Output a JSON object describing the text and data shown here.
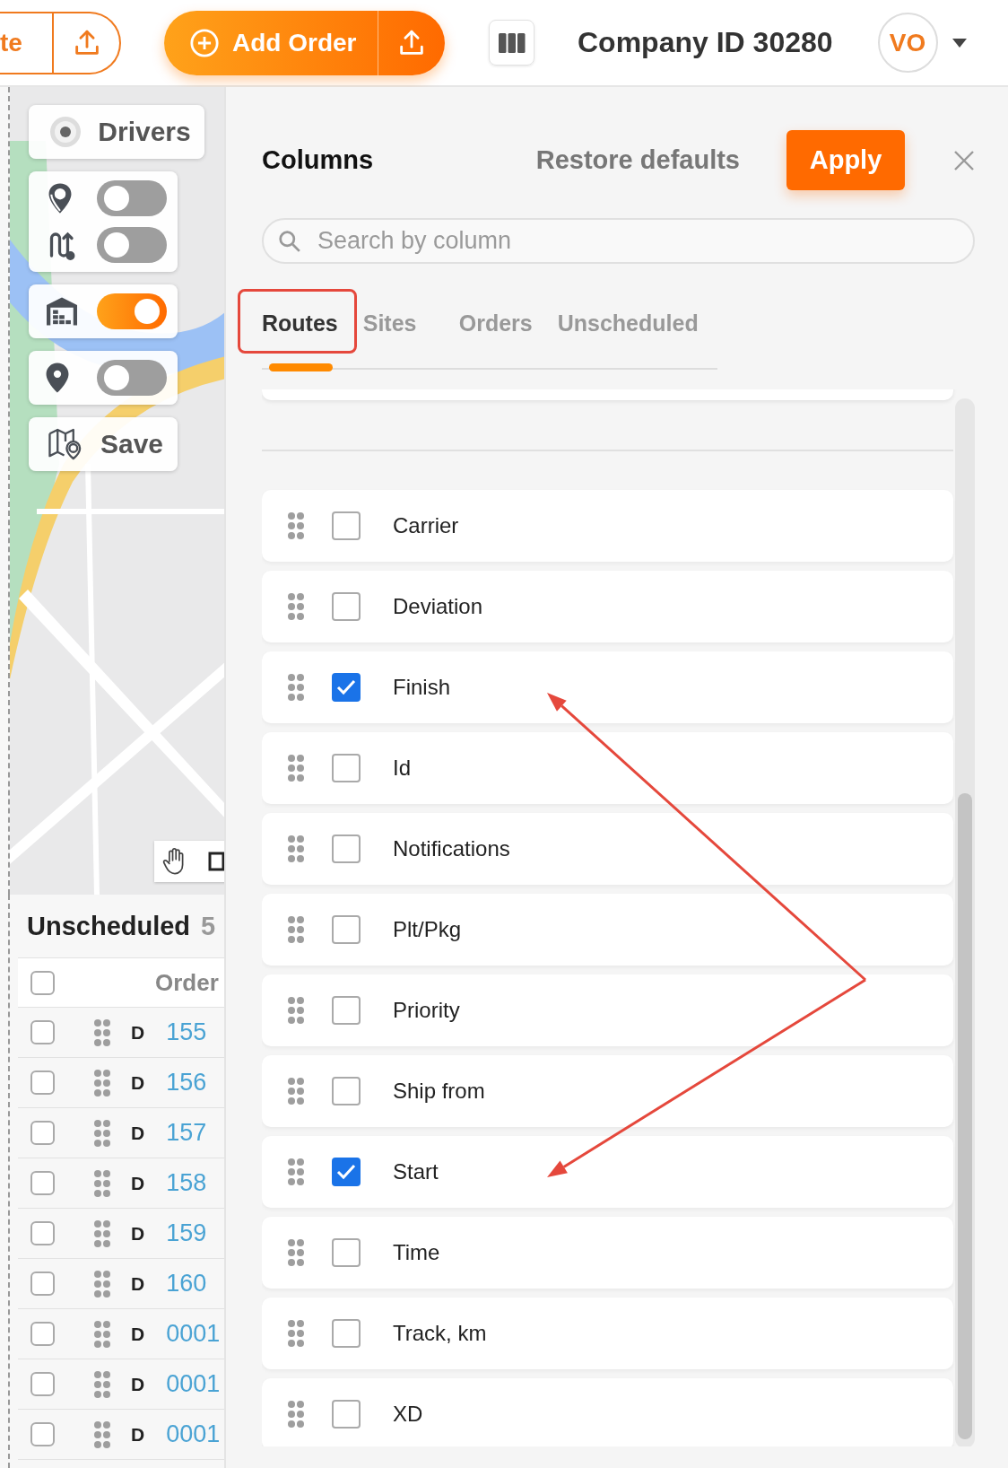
{
  "toolbar": {
    "partial_button": "te",
    "add_order": "Add Order",
    "company": "Company ID 30280",
    "avatar": "VO"
  },
  "map_controls": {
    "drivers": "Drivers",
    "toggles": [
      {
        "kind": "stops",
        "on": false
      },
      {
        "kind": "route",
        "on": false
      },
      {
        "kind": "warehouse",
        "on": true
      },
      {
        "kind": "pin",
        "on": false
      }
    ],
    "save": "Save"
  },
  "unscheduled": {
    "title": "Unscheduled",
    "count": "5",
    "header": {
      "checked": false,
      "column": "Order"
    },
    "rows": [
      {
        "checked": false,
        "type": "D",
        "order": "155"
      },
      {
        "checked": false,
        "type": "D",
        "order": "156"
      },
      {
        "checked": false,
        "type": "D",
        "order": "157"
      },
      {
        "checked": false,
        "type": "D",
        "order": "158"
      },
      {
        "checked": false,
        "type": "D",
        "order": "159"
      },
      {
        "checked": false,
        "type": "D",
        "order": "160"
      },
      {
        "checked": false,
        "type": "D",
        "order": "0001"
      },
      {
        "checked": false,
        "type": "D",
        "order": "0001"
      },
      {
        "checked": false,
        "type": "D",
        "order": "0001"
      }
    ]
  },
  "columns_panel": {
    "title": "Columns",
    "restore": "Restore defaults",
    "apply": "Apply",
    "search": {
      "placeholder": "Search by column"
    },
    "tabs": [
      {
        "label": "Routes",
        "selected": true,
        "outlined": true
      },
      {
        "label": "Sites",
        "selected": false,
        "outlined": false
      },
      {
        "label": "Orders",
        "selected": false,
        "outlined": false
      },
      {
        "label": "Unscheduled",
        "selected": false,
        "outlined": false
      }
    ],
    "items": [
      {
        "label": "Carrier",
        "checked": false,
        "arrow": false
      },
      {
        "label": "Deviation",
        "checked": false,
        "arrow": false
      },
      {
        "label": "Finish",
        "checked": true,
        "arrow": true
      },
      {
        "label": "Id",
        "checked": false,
        "arrow": false
      },
      {
        "label": "Notifications",
        "checked": false,
        "arrow": false
      },
      {
        "label": "Plt/Pkg",
        "checked": false,
        "arrow": false
      },
      {
        "label": "Priority",
        "checked": false,
        "arrow": false
      },
      {
        "label": "Ship from",
        "checked": false,
        "arrow": false
      },
      {
        "label": "Start",
        "checked": true,
        "arrow": true
      },
      {
        "label": "Time",
        "checked": false,
        "arrow": false
      },
      {
        "label": "Track, km",
        "checked": false,
        "arrow": false
      },
      {
        "label": "XD",
        "checked": false,
        "arrow": false
      }
    ]
  }
}
